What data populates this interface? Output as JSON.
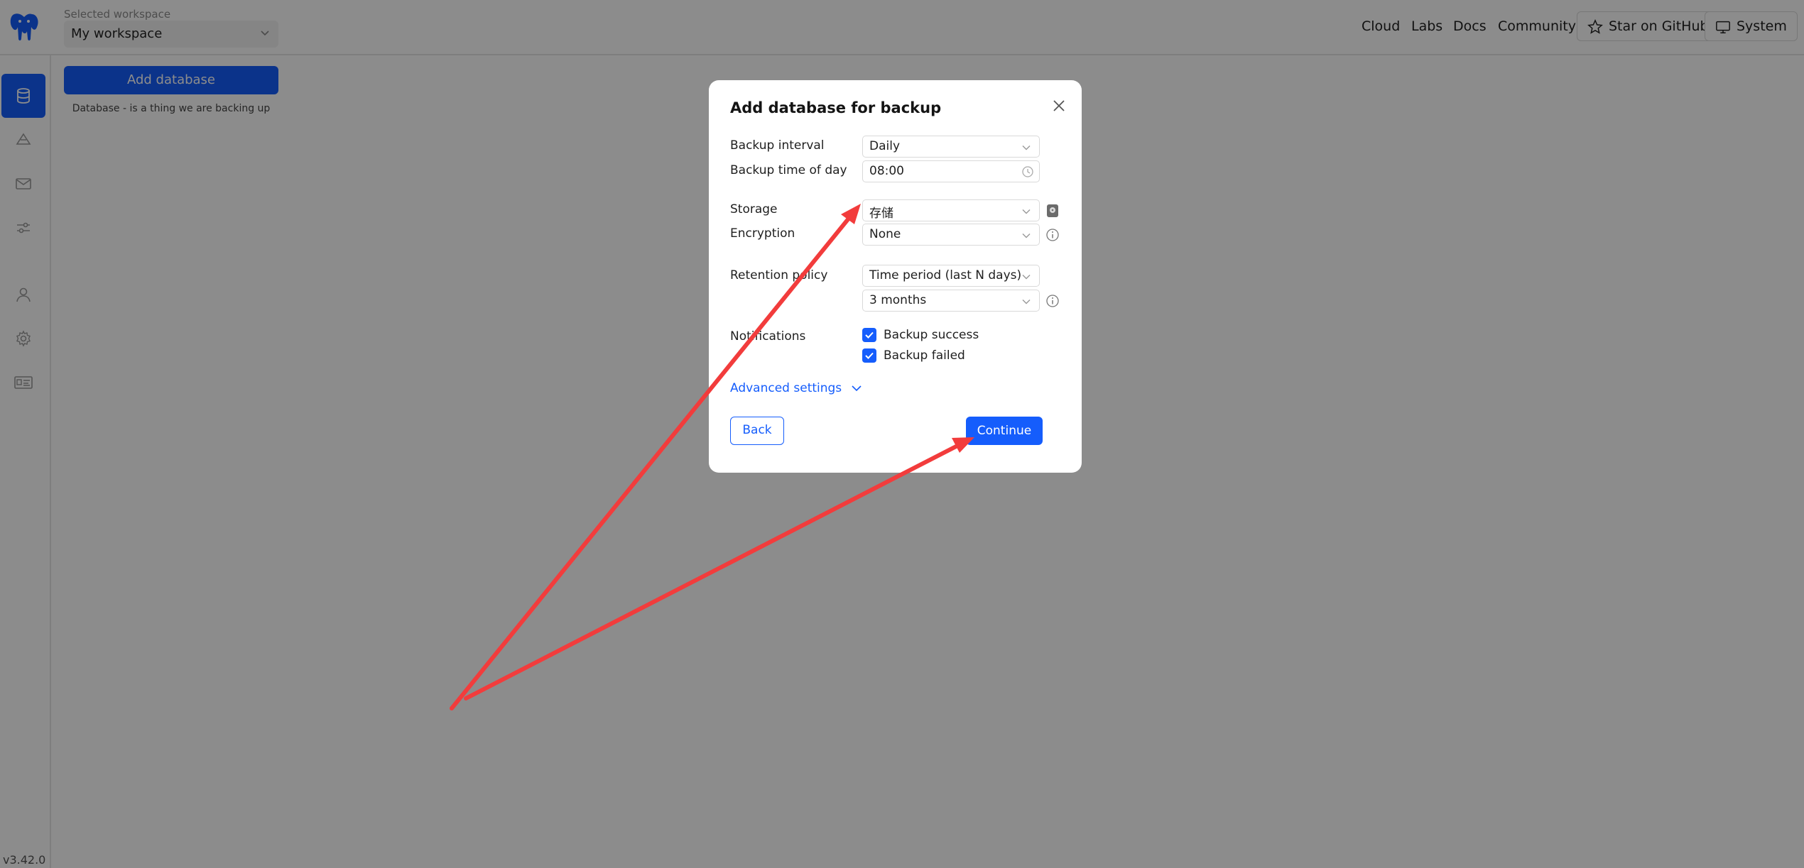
{
  "header": {
    "workspace_caption": "Selected workspace",
    "workspace_value": "My workspace",
    "links": [
      "Cloud",
      "Labs",
      "Docs",
      "Community"
    ],
    "github_label": "Star on GitHub",
    "system_label": "System"
  },
  "sidebar": {
    "items": [
      {
        "icon": "database-icon",
        "active": true
      },
      {
        "icon": "storage-icon",
        "active": false
      },
      {
        "icon": "mail-icon",
        "active": false
      },
      {
        "icon": "sliders-icon",
        "active": false
      },
      {
        "icon": "user-icon",
        "active": false
      },
      {
        "icon": "gear-icon",
        "active": false
      },
      {
        "icon": "id-card-icon",
        "active": false
      }
    ],
    "version": "v3.42.0"
  },
  "main": {
    "add_button": "Add database",
    "hint": "Database - is a thing we are backing up"
  },
  "modal": {
    "title": "Add database for backup",
    "backup_interval": {
      "label": "Backup interval",
      "value": "Daily"
    },
    "backup_time": {
      "label": "Backup time of day",
      "value": "08:00"
    },
    "storage": {
      "label": "Storage",
      "value": "存储"
    },
    "encryption": {
      "label": "Encryption",
      "value": "None"
    },
    "retention": {
      "label": "Retention policy",
      "type_value": "Time period (last N days)",
      "period_value": "3 months"
    },
    "notifications": {
      "label": "Notifications",
      "options": [
        {
          "label": "Backup success",
          "checked": true
        },
        {
          "label": "Backup failed",
          "checked": true
        }
      ]
    },
    "advanced_link": "Advanced settings",
    "back_button": "Back",
    "continue_button": "Continue"
  },
  "colors": {
    "accent": "#155dfc",
    "annotation_arrow": "#f23c3c",
    "overlay": "rgba(0,0,0,0.45)"
  }
}
